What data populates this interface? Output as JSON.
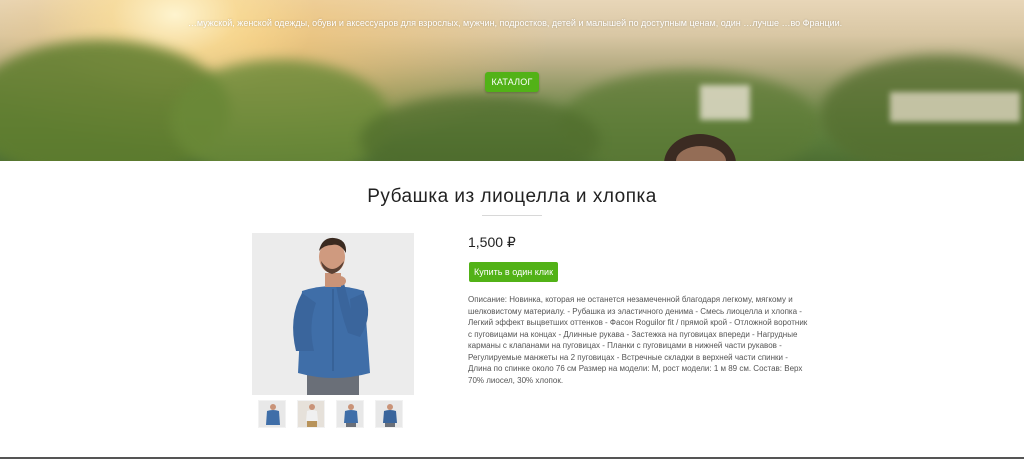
{
  "hero": {
    "text": "…мужской, женской одежды, обуви и аксессуаров для взрослых, мужчин, подростков, детей и малышей по доступным ценам, один …лучше …во Франции.",
    "catalog_button": "КАТАЛОГ"
  },
  "product": {
    "title": "Рубашка из лиоцелла и хлопка",
    "price": "1,500 ₽",
    "buy_button": "Купить в один клик",
    "description": "Описание: Новинка, которая не останется незамеченной благодаря легкому, мягкому и шелковистому материалу. - Рубашка из эластичного денима - Смесь лиоцелла и хлопка - Легкий эффект выцветших оттенков - Фасон Roguilor fit / прямой крой - Отложной воротник с пуговицами на концах - Длинные рукава - Застежка на пуговицах впереди - Нагрудные карманы с клапанами на пуговицах - Планки с пуговицами в нижней части рукавов - Регулируемые манжеты на 2 пуговицах - Встречные складки в верхней части спинки - Длина по спинке около 76 см Размер на модели: M, рост модели: 1 м 89 см. Состав: Верх 70% лиосел, 30% хлопок."
  },
  "colors": {
    "accent_green": "#52b217",
    "shirt_blue": "#3f6ea8"
  }
}
